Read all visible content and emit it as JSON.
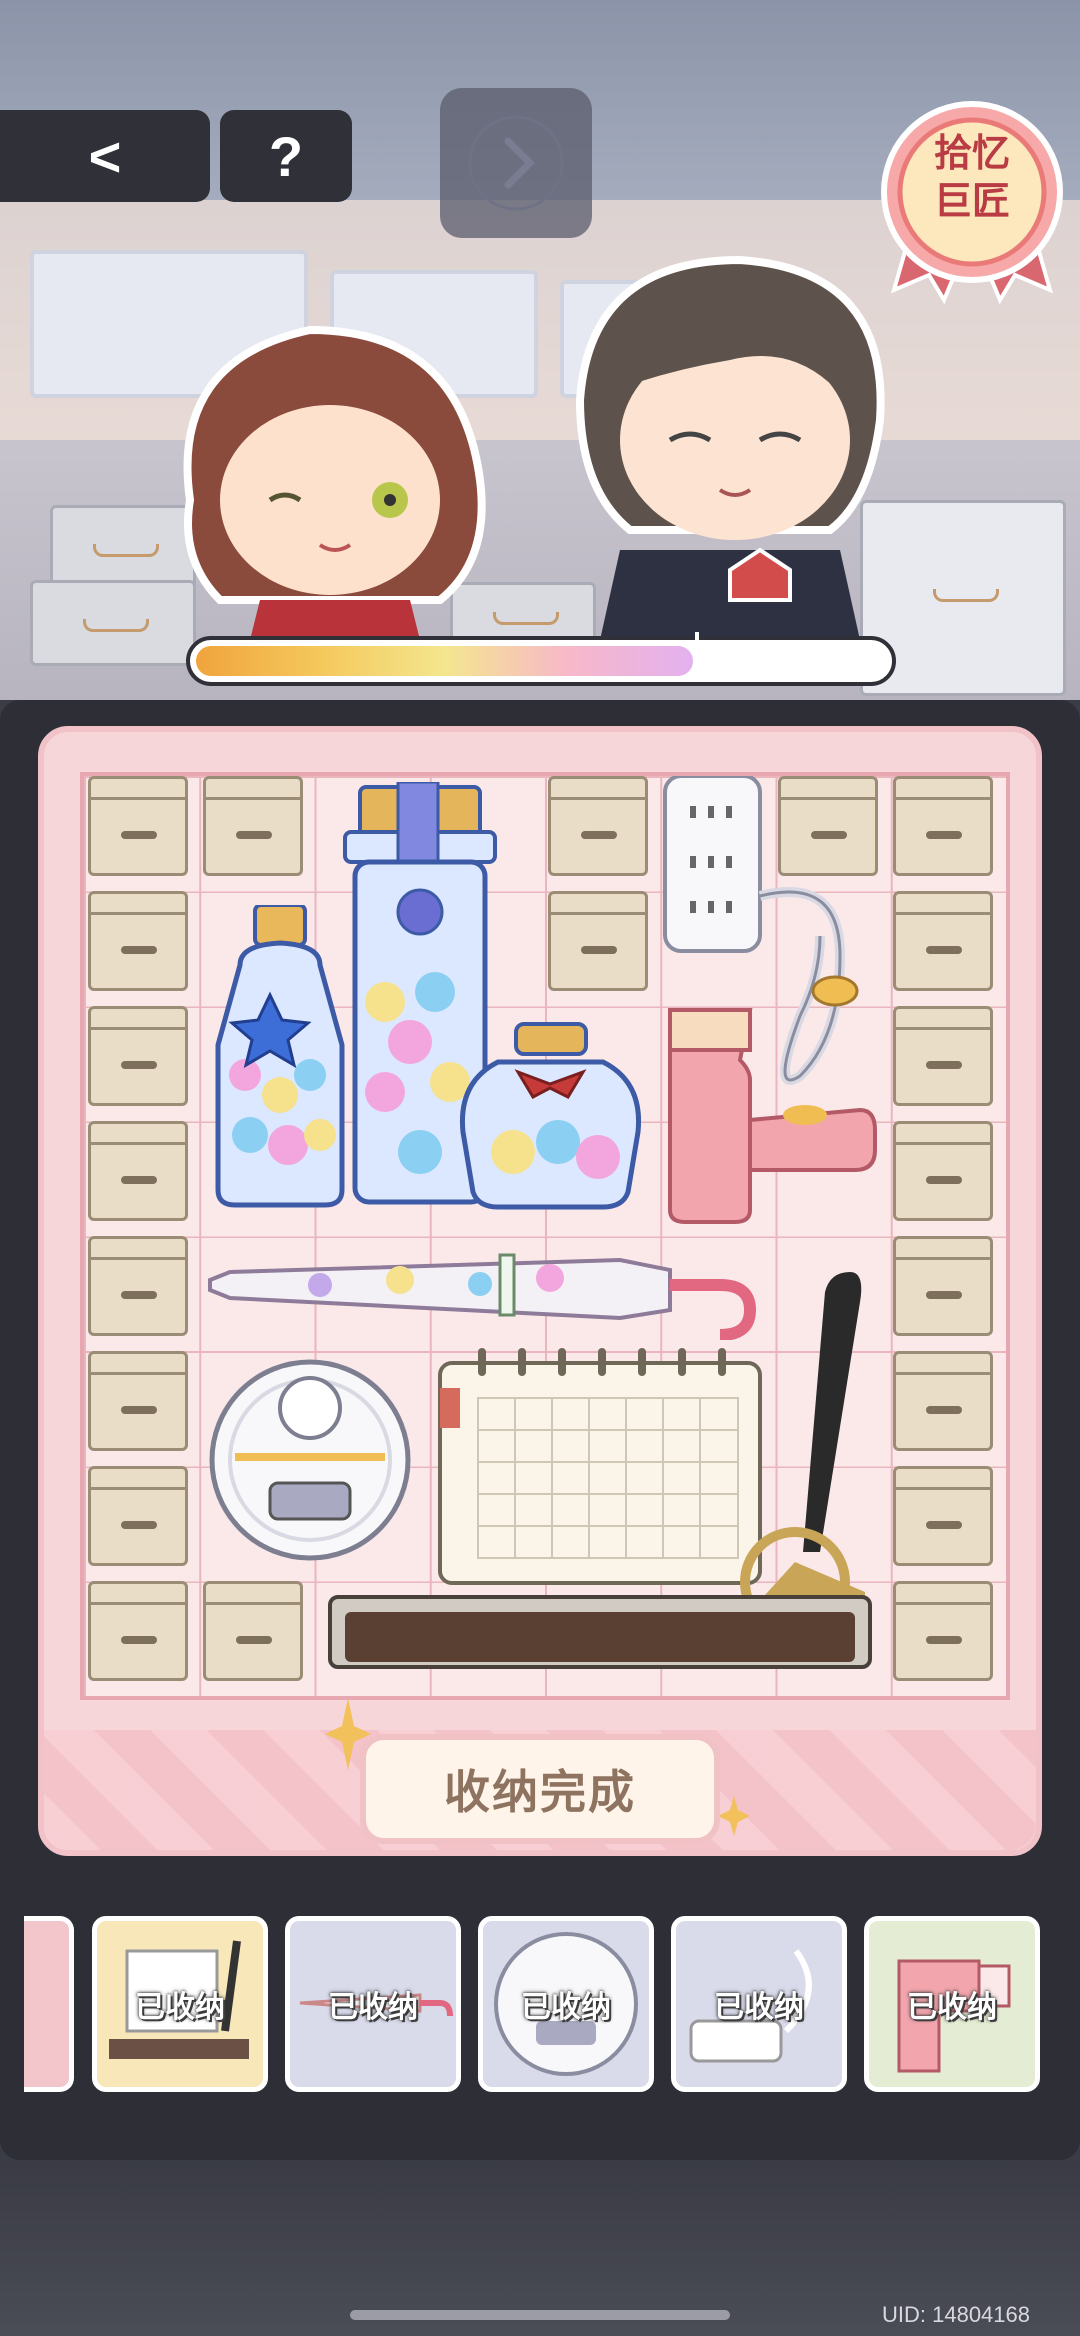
{
  "header": {
    "back_glyph": "<",
    "help_glyph": "?",
    "next_glyph": ">",
    "badge_line1": "拾忆",
    "badge_line2": "巨匠"
  },
  "progress": {
    "value": 0.72
  },
  "board": {
    "complete_label": "收纳完成",
    "items": [
      "water-bottle",
      "tall-bottle",
      "candy-jar",
      "power-strip",
      "hair-dryer",
      "umbrella",
      "robot-vacuum",
      "calendar",
      "pen-holder"
    ]
  },
  "tray": {
    "cards": [
      {
        "label": "已收纳",
        "icon": "pen-calendar-icon",
        "color": "#f7e7b9"
      },
      {
        "label": "已收纳",
        "icon": "umbrella-icon",
        "color": "#d9dbeb"
      },
      {
        "label": "已收纳",
        "icon": "robot-vacuum-icon",
        "color": "#d9dbeb"
      },
      {
        "label": "已收纳",
        "icon": "power-strip-icon",
        "color": "#d9dbeb"
      },
      {
        "label": "已收纳",
        "icon": "hair-dryer-icon",
        "color": "#e4ecd3"
      }
    ]
  },
  "footer": {
    "uid": "UID: 14804168"
  }
}
